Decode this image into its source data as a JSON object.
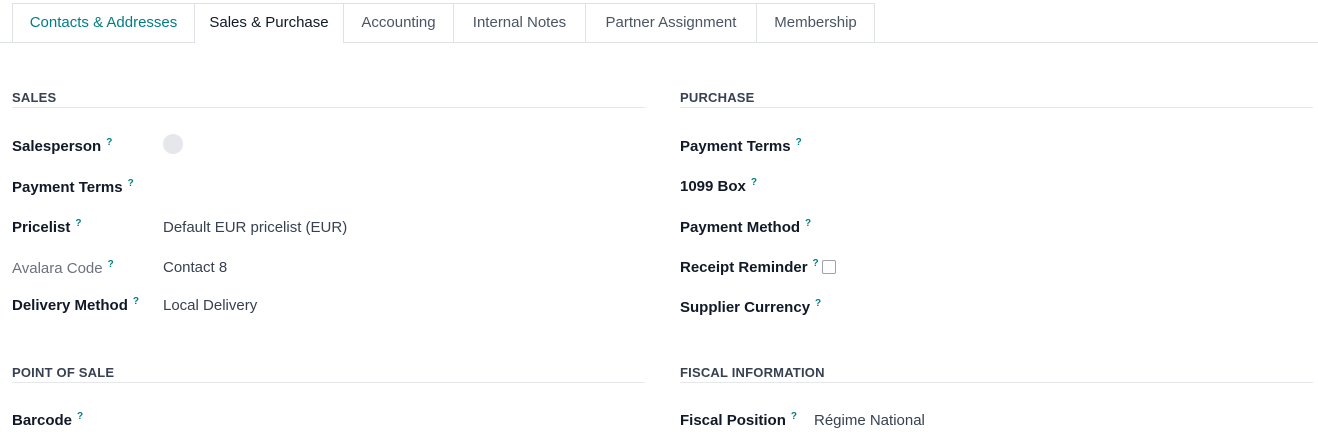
{
  "tabs": [
    {
      "label": "Contacts & Addresses"
    },
    {
      "label": "Sales & Purchase"
    },
    {
      "label": "Accounting"
    },
    {
      "label": "Internal Notes"
    },
    {
      "label": "Partner Assignment"
    },
    {
      "label": "Membership"
    }
  ],
  "help_mark": "?",
  "sales": {
    "title": "SALES",
    "salesperson_label": "Salesperson",
    "payment_terms_label": "Payment Terms",
    "pricelist_label": "Pricelist",
    "pricelist_value": "Default EUR pricelist (EUR)",
    "avalara_label": "Avalara Code",
    "avalara_value": "Contact 8",
    "delivery_label": "Delivery Method",
    "delivery_value": "Local Delivery"
  },
  "purchase": {
    "title": "PURCHASE",
    "payment_terms_label": "Payment Terms",
    "box1099_label": "1099 Box",
    "payment_method_label": "Payment Method",
    "receipt_reminder_label": "Receipt Reminder",
    "receipt_reminder_checked": false,
    "supplier_currency_label": "Supplier Currency"
  },
  "pos": {
    "title": "POINT OF SALE",
    "barcode_label": "Barcode"
  },
  "fiscal": {
    "title": "FISCAL INFORMATION",
    "fiscal_position_label": "Fiscal Position",
    "fiscal_position_value": "Régime National"
  },
  "icons": {
    "salesperson_avatar": "avatar-placeholder",
    "receipt_checkbox": "checkbox-unchecked"
  },
  "colors": {
    "accent": "#017e84",
    "border": "#dee2e6",
    "text": "#111827",
    "muted": "#6b7280"
  }
}
